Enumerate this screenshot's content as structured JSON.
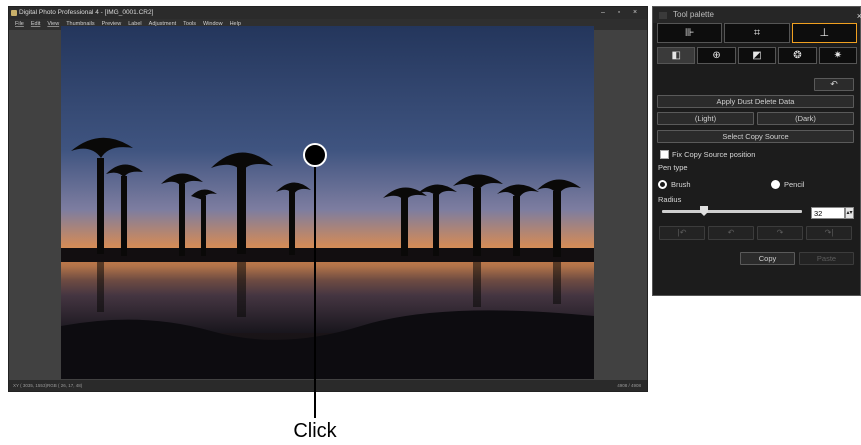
{
  "window": {
    "title": "Digital Photo Professional 4 - [IMG_0001.CR2]",
    "controls": [
      "–",
      "▫",
      "×"
    ]
  },
  "menu": [
    "File",
    "Edit",
    "View",
    "Thumbnails",
    "Preview",
    "Label",
    "Adjustment",
    "Tools",
    "Window",
    "Help"
  ],
  "status": {
    "left": "XY ( 3035, 1553)RGB ( 26, 17, 48)",
    "right": "4908 / 4908"
  },
  "annotation": {
    "label": "Click"
  },
  "palette": {
    "title": "Tool palette",
    "close": "×",
    "tabs_top": [
      {
        "icon": "compare-icon",
        "glyph": "⊪",
        "active": false
      },
      {
        "icon": "crop-icon",
        "glyph": "⌗",
        "active": false
      },
      {
        "icon": "stamp-icon",
        "glyph": "⊥",
        "active": true
      }
    ],
    "tabs_sub": [
      {
        "icon": "basic-adjust-icon",
        "glyph": "◧",
        "active": true
      },
      {
        "icon": "detail-icon",
        "glyph": "⊕",
        "active": false
      },
      {
        "icon": "tone-curve-icon",
        "glyph": "◩",
        "active": false
      },
      {
        "icon": "color-icon",
        "glyph": "❂",
        "active": false
      },
      {
        "icon": "settings-icon",
        "glyph": "✷",
        "active": false
      }
    ],
    "undo_glyph": "↶",
    "apply_dust": "Apply Dust Delete Data",
    "light": "(Light)",
    "dark": "(Dark)",
    "select_copy_source": "Select Copy Source",
    "fix_copy_source": "Fix Copy Source position",
    "pen_type": "Pen type",
    "brush": "Brush",
    "pencil": "Pencil",
    "radius": "Radius",
    "radius_value": "32",
    "radius_fraction": 0.3,
    "nav_glyphs": [
      "|↶",
      "↶",
      "↷",
      "↷|"
    ],
    "copy": "Copy",
    "paste": "Paste"
  }
}
